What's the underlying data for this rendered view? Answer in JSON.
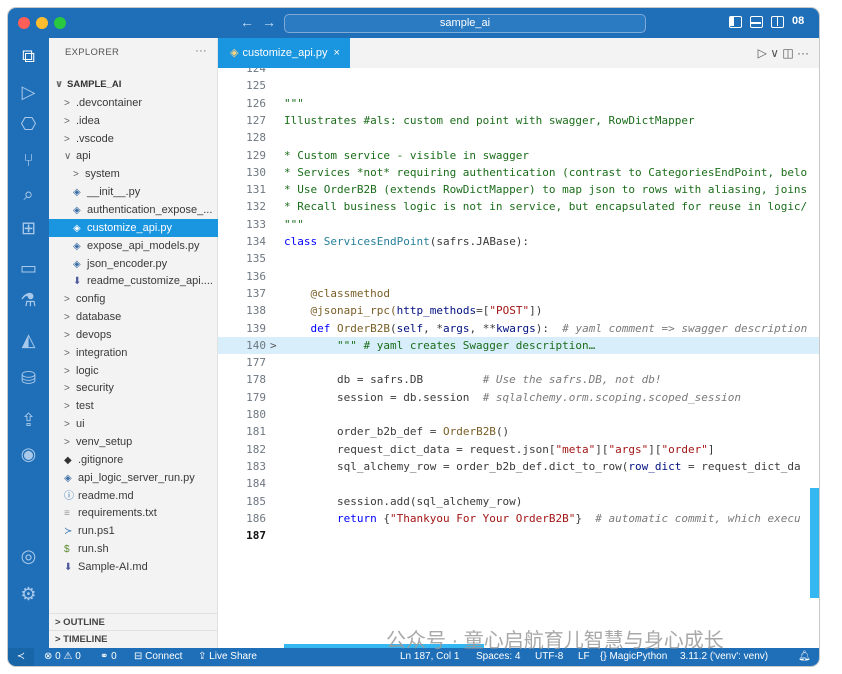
{
  "titlebar": {
    "search_text": "sample_ai",
    "back": "←",
    "forward": "→",
    "layout_extra": "08"
  },
  "activity": [
    {
      "name": "explorer-icon",
      "glyph": "⧉",
      "active": true
    },
    {
      "name": "run-debug-icon",
      "glyph": "▷"
    },
    {
      "name": "source-control-icon",
      "glyph": "⎔"
    },
    {
      "name": "git-graph-icon",
      "glyph": "⑂"
    },
    {
      "name": "search-icon",
      "glyph": "⌕"
    },
    {
      "name": "extensions-icon",
      "glyph": "⊞"
    },
    {
      "name": "remote-explorer-icon",
      "glyph": "▭"
    },
    {
      "name": "testing-icon",
      "glyph": "⚗"
    },
    {
      "name": "docker-icon",
      "glyph": "◭"
    },
    {
      "name": "database-icon",
      "glyph": "⛁"
    },
    {
      "name": "live-share-icon",
      "glyph": "⇪"
    },
    {
      "name": "github-icon",
      "glyph": "◉"
    },
    {
      "name": "account-icon",
      "glyph": "◎"
    },
    {
      "name": "settings-gear-icon",
      "glyph": "⚙"
    }
  ],
  "sidebar": {
    "header": "EXPLORER",
    "more": "···",
    "tree": [
      {
        "label": "SAMPLE_AI",
        "caret": "∨",
        "indent": 0,
        "type": "root"
      },
      {
        "label": ".devcontainer",
        "caret": ">",
        "indent": 1
      },
      {
        "label": ".idea",
        "caret": ">",
        "indent": 1
      },
      {
        "label": ".vscode",
        "caret": ">",
        "indent": 1
      },
      {
        "label": "api",
        "caret": "∨",
        "indent": 1
      },
      {
        "label": "system",
        "caret": ">",
        "indent": 2
      },
      {
        "label": "__init__.py",
        "icon": "py",
        "indent": 2
      },
      {
        "label": "authentication_expose_...",
        "icon": "py",
        "indent": 2
      },
      {
        "label": "customize_api.py",
        "icon": "py",
        "indent": 2,
        "selected": true
      },
      {
        "label": "expose_api_models.py",
        "icon": "py",
        "indent": 2
      },
      {
        "label": "json_encoder.py",
        "icon": "py",
        "indent": 2
      },
      {
        "label": "readme_customize_api....",
        "icon": "md",
        "indent": 2
      },
      {
        "label": "config",
        "caret": ">",
        "indent": 1
      },
      {
        "label": "database",
        "caret": ">",
        "indent": 1
      },
      {
        "label": "devops",
        "caret": ">",
        "indent": 1
      },
      {
        "label": "integration",
        "caret": ">",
        "indent": 1
      },
      {
        "label": "logic",
        "caret": ">",
        "indent": 1
      },
      {
        "label": "security",
        "caret": ">",
        "indent": 1
      },
      {
        "label": "test",
        "caret": ">",
        "indent": 1
      },
      {
        "label": "ui",
        "caret": ">",
        "indent": 1
      },
      {
        "label": "venv_setup",
        "caret": ">",
        "indent": 1
      },
      {
        "label": ".gitignore",
        "icon": "git",
        "indent": 1
      },
      {
        "label": "api_logic_server_run.py",
        "icon": "py",
        "indent": 1
      },
      {
        "label": "readme.md",
        "icon": "info",
        "indent": 1
      },
      {
        "label": "requirements.txt",
        "icon": "txt",
        "indent": 1
      },
      {
        "label": "run.ps1",
        "icon": "ps",
        "indent": 1
      },
      {
        "label": "run.sh",
        "icon": "sh",
        "indent": 1
      },
      {
        "label": "Sample-AI.md",
        "icon": "md",
        "indent": 1
      }
    ],
    "outline": "> OUTLINE",
    "timeline": "> TIMELINE"
  },
  "editor": {
    "tab_label": "customize_api.py",
    "tab_close": "×",
    "actions": "▷ ∨  ◫  ···",
    "current_line": "187",
    "lines": [
      {
        "n": "124",
        "tokens": []
      },
      {
        "n": "125",
        "tokens": []
      },
      {
        "n": "126",
        "tokens": [
          {
            "t": "\"\"\"",
            "c": "doc"
          }
        ]
      },
      {
        "n": "127",
        "tokens": [
          {
            "t": "Illustrates #als: custom end point with swagger, RowDictMapper",
            "c": "doc"
          }
        ]
      },
      {
        "n": "128",
        "tokens": []
      },
      {
        "n": "129",
        "tokens": [
          {
            "t": "* Custom service - visible in swagger",
            "c": "doc"
          }
        ]
      },
      {
        "n": "130",
        "tokens": [
          {
            "t": "* Services *not* requiring authentication (contrast to CategoriesEndPoint, belo",
            "c": "doc"
          }
        ]
      },
      {
        "n": "131",
        "tokens": [
          {
            "t": "* Use OrderB2B (extends RowDictMapper) to map json to rows with aliasing, joins",
            "c": "doc"
          }
        ]
      },
      {
        "n": "132",
        "tokens": [
          {
            "t": "* Recall business logic is not in service, but encapsulated for reuse in logic/",
            "c": "doc"
          }
        ]
      },
      {
        "n": "133",
        "tokens": [
          {
            "t": "\"\"\"",
            "c": "doc"
          }
        ]
      },
      {
        "n": "134",
        "tokens": [
          {
            "t": "class ",
            "c": "kw"
          },
          {
            "t": "ServicesEndPoint",
            "c": "cls"
          },
          {
            "t": "(safrs.JABase):",
            "c": ""
          }
        ]
      },
      {
        "n": "135",
        "tokens": []
      },
      {
        "n": "136",
        "tokens": []
      },
      {
        "n": "137",
        "tokens": [
          {
            "t": "    @classmethod",
            "c": "deco"
          }
        ]
      },
      {
        "n": "138",
        "tokens": [
          {
            "t": "    @jsonapi_rpc(",
            "c": "deco"
          },
          {
            "t": "http_methods",
            "c": "param"
          },
          {
            "t": "=[",
            "c": ""
          },
          {
            "t": "\"POST\"",
            "c": "str"
          },
          {
            "t": "])",
            "c": ""
          }
        ]
      },
      {
        "n": "139",
        "tokens": [
          {
            "t": "    def ",
            "c": "kw"
          },
          {
            "t": "OrderB2B",
            "c": "fn"
          },
          {
            "t": "(",
            "c": ""
          },
          {
            "t": "self",
            "c": "param"
          },
          {
            "t": ", *",
            "c": ""
          },
          {
            "t": "args",
            "c": "param"
          },
          {
            "t": ", **",
            "c": ""
          },
          {
            "t": "kwargs",
            "c": "param"
          },
          {
            "t": "):  ",
            "c": ""
          },
          {
            "t": "# yaml comment => swagger description",
            "c": "cmt"
          }
        ]
      },
      {
        "n": "140",
        "fold": ">",
        "highlight": true,
        "tokens": [
          {
            "t": "        \"\"\" # yaml creates Swagger description…",
            "c": "doc"
          }
        ]
      },
      {
        "n": "177",
        "tokens": []
      },
      {
        "n": "178",
        "tokens": [
          {
            "t": "        db = safrs.DB         ",
            "c": ""
          },
          {
            "t": "# Use the safrs.DB, not db!",
            "c": "cmt"
          }
        ]
      },
      {
        "n": "179",
        "tokens": [
          {
            "t": "        session = db.session  ",
            "c": ""
          },
          {
            "t": "# sqlalchemy.orm.scoping.scoped_session",
            "c": "cmt"
          }
        ]
      },
      {
        "n": "180",
        "tokens": []
      },
      {
        "n": "181",
        "tokens": [
          {
            "t": "        order_b2b_def = ",
            "c": ""
          },
          {
            "t": "OrderB2B",
            "c": "fn"
          },
          {
            "t": "()",
            "c": ""
          }
        ]
      },
      {
        "n": "182",
        "tokens": [
          {
            "t": "        request_dict_data = request.json[",
            "c": ""
          },
          {
            "t": "\"meta\"",
            "c": "str"
          },
          {
            "t": "][",
            "c": ""
          },
          {
            "t": "\"args\"",
            "c": "str"
          },
          {
            "t": "][",
            "c": ""
          },
          {
            "t": "\"order\"",
            "c": "str"
          },
          {
            "t": "]",
            "c": ""
          }
        ]
      },
      {
        "n": "183",
        "tokens": [
          {
            "t": "        sql_alchemy_row = order_b2b_def.dict_to_row(",
            "c": ""
          },
          {
            "t": "row_dict",
            "c": "param"
          },
          {
            "t": " = request_dict_da",
            "c": ""
          }
        ]
      },
      {
        "n": "184",
        "tokens": []
      },
      {
        "n": "185",
        "tokens": [
          {
            "t": "        session.add(sql_alchemy_row)",
            "c": ""
          }
        ]
      },
      {
        "n": "186",
        "tokens": [
          {
            "t": "        return ",
            "c": "kw"
          },
          {
            "t": "{",
            "c": ""
          },
          {
            "t": "\"Thankyou For Your OrderB2B\"",
            "c": "str"
          },
          {
            "t": "}  ",
            "c": ""
          },
          {
            "t": "# automatic commit, which execu",
            "c": "cmt"
          }
        ]
      },
      {
        "n": "187",
        "tokens": []
      }
    ]
  },
  "statusbar": {
    "remote": "≺",
    "problems": "⊗ 0 ⚠ 0",
    "ports": "⚭ 0",
    "connect": "⊟ Connect",
    "live_share": "⇪ Live Share",
    "position": "Ln 187, Col 1",
    "spaces": "Spaces: 4",
    "encoding": "UTF-8",
    "eol": "LF",
    "language": "{} MagicPython",
    "interpreter": "3.11.2 ('venv': venv)",
    "bell": "🔔︎"
  },
  "watermark": "公众号 · 童心启航育儿智慧与身心成长"
}
